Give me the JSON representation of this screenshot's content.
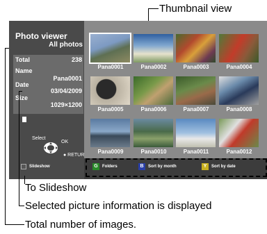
{
  "callouts": {
    "thumbnail_view": "Thumbnail view",
    "to_slideshow": "To Slideshow",
    "selected_info": "Selected picture information is displayed",
    "total_images": "Total number of images."
  },
  "sidebar": {
    "title": "Photo viewer",
    "subtitle": "All photos",
    "total_label": "Total",
    "total_value": "238",
    "name_label": "Name",
    "name_value": "Pana0001",
    "date_label": "Date",
    "date_value": "03/04/2009",
    "size_label": "Size",
    "size_value": "1029×1200",
    "select_label": "Select",
    "ok_label": "OK",
    "return_label": "● RETURN",
    "slideshow_key": "R",
    "slideshow_label": "Slideshow"
  },
  "thumbnails": [
    {
      "label": "Pana0001",
      "selected": true
    },
    {
      "label": "Pana0002",
      "selected": false
    },
    {
      "label": "Pana0003",
      "selected": false
    },
    {
      "label": "Pana0004",
      "selected": false
    },
    {
      "label": "Pana0005",
      "selected": false
    },
    {
      "label": "Pana0006",
      "selected": false
    },
    {
      "label": "Pana0007",
      "selected": false
    },
    {
      "label": "Pana0008",
      "selected": false
    },
    {
      "label": "Pana0009",
      "selected": false
    },
    {
      "label": "Pana0010",
      "selected": false
    },
    {
      "label": "Pana0011",
      "selected": false
    },
    {
      "label": "Pana0012",
      "selected": false
    }
  ],
  "bottom_bar": {
    "folders_key": "G",
    "folders_label": "Folders",
    "month_key": "B",
    "month_label": "Sort by month",
    "date_key": "Y",
    "date_label": "Sort by date"
  },
  "colors": {
    "green_key": "#2a8a2a",
    "blue_key": "#2a3fa8",
    "yellow_key": "#c8b020"
  }
}
